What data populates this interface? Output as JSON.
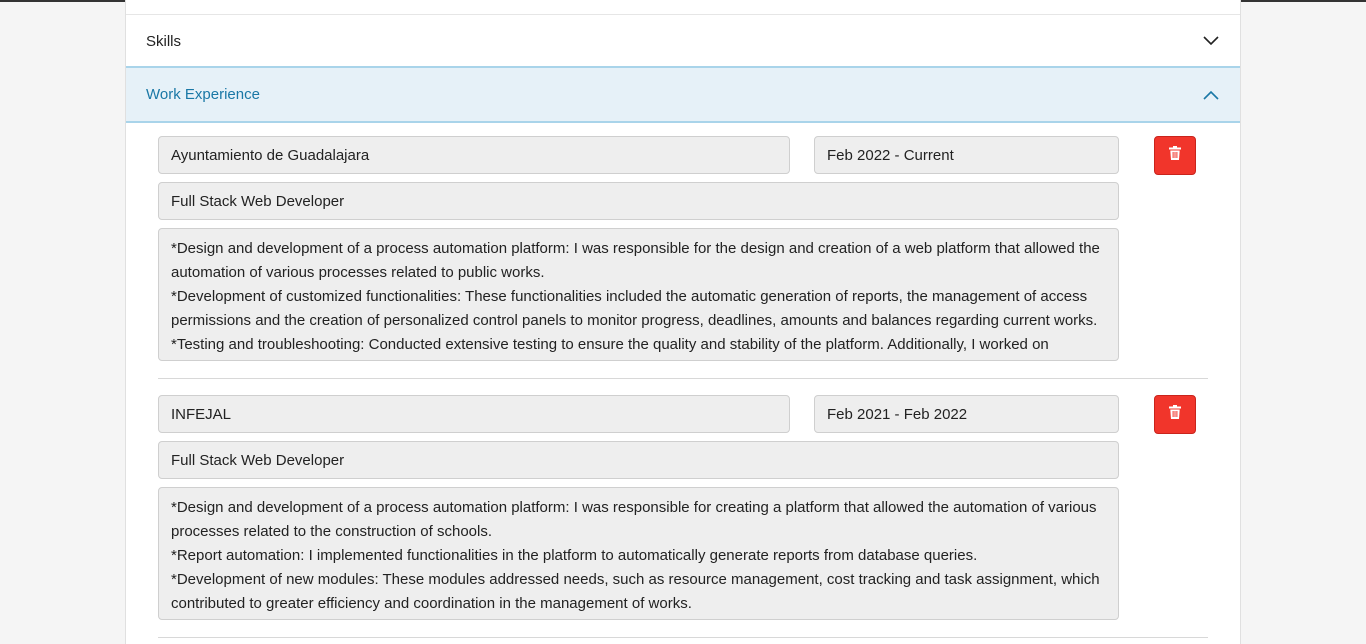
{
  "accordion": {
    "skills_label": "Skills",
    "work_label": "Work Experience"
  },
  "colors": {
    "accent": "#1a78a6",
    "active_bg": "#e6f1f8",
    "danger": "#f1352b"
  },
  "icons": {
    "collapsed": "chevron-down-icon",
    "expanded": "chevron-up-icon",
    "delete": "trash-icon"
  },
  "work": [
    {
      "company": "Ayuntamiento de Guadalajara",
      "dates": "Feb 2022 - Current",
      "role": "Full Stack Web Developer",
      "description": "*Design and development of a process automation platform: I was responsible for the design and creation of a web platform that allowed the automation of various processes related to public works.\n*Development of customized functionalities: These functionalities included the automatic generation of reports, the management of access permissions and the creation of personalized control panels to monitor progress, deadlines, amounts and balances regarding current works.\n*Testing and troubleshooting: Conducted extensive testing to ensure the quality and stability of the platform. Additionally, I worked on"
    },
    {
      "company": "INFEJAL",
      "dates": "Feb 2021 - Feb 2022",
      "role": "Full Stack Web Developer",
      "description": "*Design and development of a process automation platform: I was responsible for creating a platform that allowed the automation of various processes related to the construction of schools.\n*Report automation: I implemented functionalities in the platform to automatically generate reports from database queries.\n*Development of new modules: These modules addressed needs, such as resource management, cost tracking and task assignment, which contributed to greater efficiency and coordination in the management of works."
    }
  ]
}
